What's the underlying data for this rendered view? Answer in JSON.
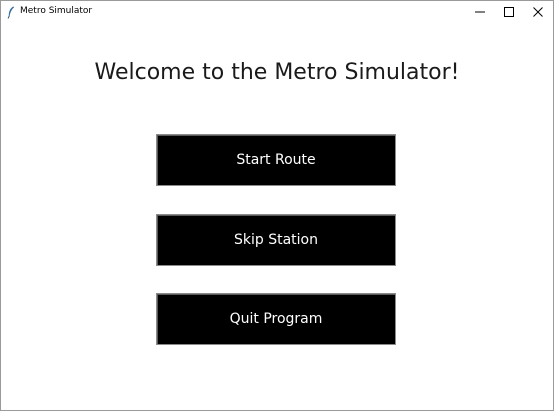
{
  "window": {
    "title": "Metro Simulator",
    "app_icon": "feather-icon",
    "controls": {
      "minimize_icon": "minimize-icon",
      "maximize_icon": "maximize-icon",
      "close_icon": "close-icon"
    }
  },
  "main": {
    "heading": "Welcome to the Metro Simulator!",
    "buttons": {
      "start_route": "Start Route",
      "skip_station": "Skip Station",
      "quit_program": "Quit Program"
    }
  },
  "colors": {
    "button_background": "#000000",
    "button_text": "#ffffff",
    "window_background": "#ffffff"
  }
}
